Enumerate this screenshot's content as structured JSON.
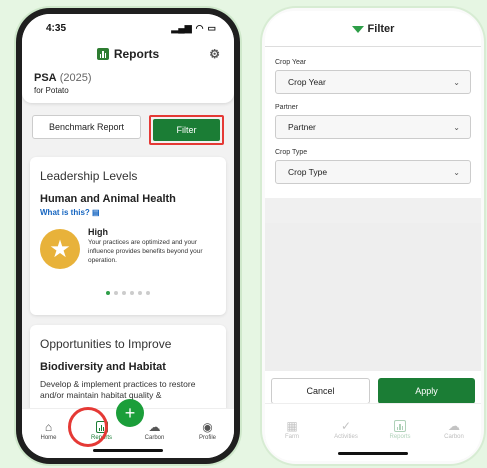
{
  "left": {
    "status": {
      "time": "4:35"
    },
    "appbar": {
      "title": "Reports",
      "gear_icon": "gear-icon",
      "reports_icon": "bar-chart-icon"
    },
    "psa": {
      "name": "PSA",
      "year": "(2025)",
      "subtitle": "for Potato"
    },
    "buttons": {
      "benchmark": "Benchmark Report",
      "filter": "Filter"
    },
    "leadership": {
      "heading": "Leadership Levels",
      "category": "Human and Animal Health",
      "what_is_this": "What is this?",
      "level": "High",
      "description": "Your practices are optimized and your influence provides benefits beyond your operation.",
      "carousel": {
        "count": 6,
        "active_index": 0
      }
    },
    "opportunities": {
      "heading": "Opportunities to Improve",
      "topic": "Biodiversity and Habitat",
      "text": "Develop & implement practices to restore and/or maintain habitat quality &"
    },
    "nav": [
      {
        "label": "Home",
        "icon": "home-icon"
      },
      {
        "label": "Reports",
        "icon": "bar-chart-icon"
      },
      {
        "label": "Carbon",
        "icon": "cloud-icon"
      },
      {
        "label": "Profile",
        "icon": "profile-icon"
      }
    ],
    "fab": "+"
  },
  "right": {
    "title": "Filter",
    "fields": [
      {
        "label": "Crop Year",
        "value": "Crop Year"
      },
      {
        "label": "Partner",
        "value": "Partner"
      },
      {
        "label": "Crop Type",
        "value": "Crop Type"
      }
    ],
    "actions": {
      "cancel": "Cancel",
      "apply": "Apply"
    },
    "nav": [
      {
        "label": "Farm",
        "icon": "barn-icon"
      },
      {
        "label": "Activities",
        "icon": "check-circle-icon"
      },
      {
        "label": "Reports",
        "icon": "bar-chart-icon"
      },
      {
        "label": "Carbon",
        "icon": "cloud-icon"
      }
    ]
  },
  "colors": {
    "brand_green": "#1b7d35",
    "highlight_red": "#e53935",
    "star_gold": "#e8b23a",
    "background": "#e6f6e3"
  }
}
